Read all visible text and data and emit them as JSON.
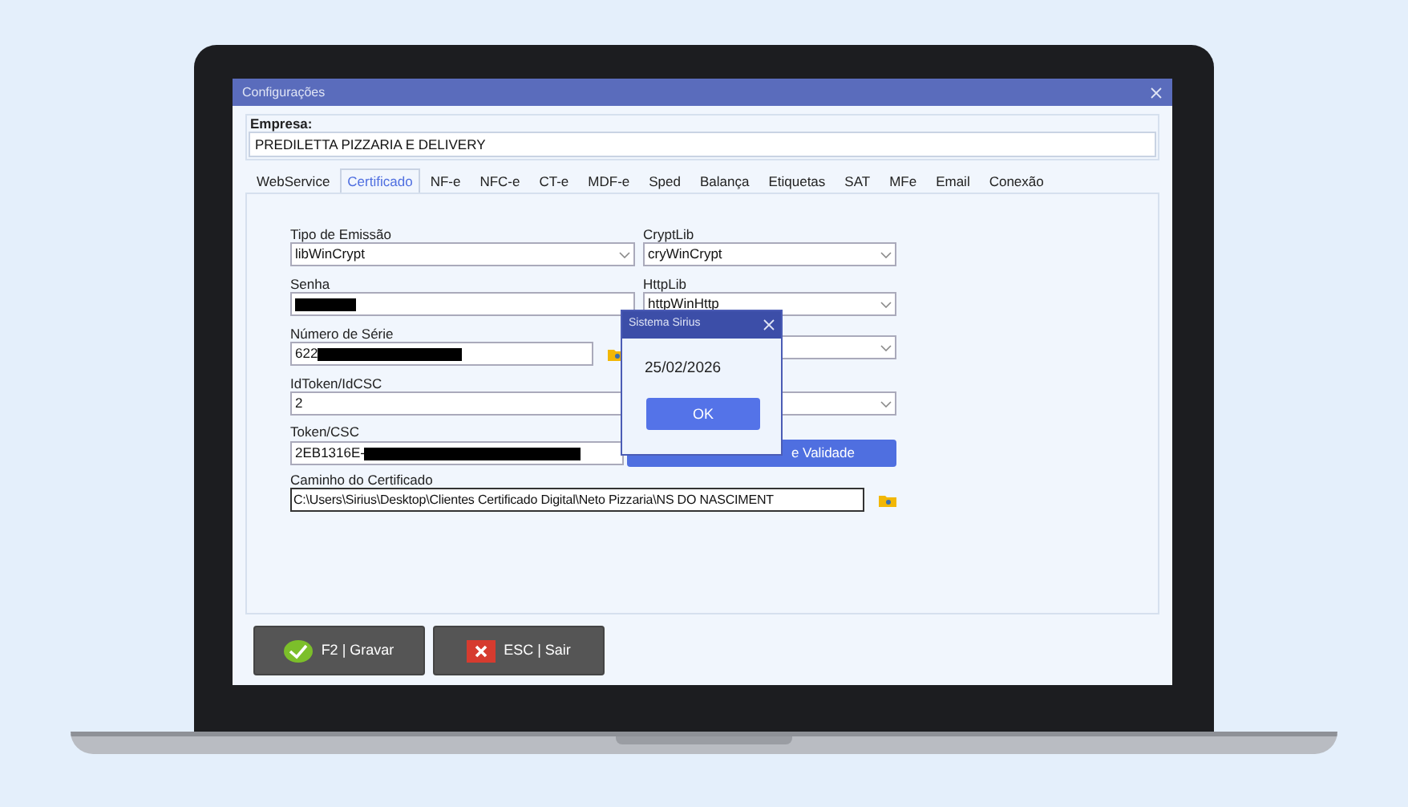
{
  "window": {
    "title": "Configurações"
  },
  "empresa": {
    "label": "Empresa:",
    "value": "PREDILETTA PIZZARIA E DELIVERY"
  },
  "tabs": [
    {
      "label": "WebService",
      "selected": false
    },
    {
      "label": "Certificado",
      "selected": true
    },
    {
      "label": "NF-e",
      "selected": false
    },
    {
      "label": "NFC-e",
      "selected": false
    },
    {
      "label": "CT-e",
      "selected": false
    },
    {
      "label": "MDF-e",
      "selected": false
    },
    {
      "label": "Sped",
      "selected": false
    },
    {
      "label": "Balança",
      "selected": false
    },
    {
      "label": "Etiquetas",
      "selected": false
    },
    {
      "label": "SAT",
      "selected": false
    },
    {
      "label": "MFe",
      "selected": false
    },
    {
      "label": "Email",
      "selected": false
    },
    {
      "label": "Conexão",
      "selected": false
    }
  ],
  "certificado": {
    "tipo_emissao": {
      "label": "Tipo de Emissão",
      "value": "libWinCrypt"
    },
    "cryptlib": {
      "label": "CryptLib",
      "value": "cryWinCrypt"
    },
    "senha": {
      "label": "Senha",
      "redacted": true
    },
    "httplib": {
      "label": "HttpLib",
      "value": "httpWinHttp"
    },
    "numero_serie": {
      "label": "Número de Série",
      "value": "622",
      "redacted": true
    },
    "id_token": {
      "label": "IdToken/IdCSC",
      "value": "2"
    },
    "token_csc": {
      "label": "Token/CSC",
      "value": "2EB1316E-",
      "redacted": true
    },
    "validade_button": {
      "label": "e Validade"
    },
    "caminho": {
      "label": "Caminho do Certificado",
      "value": "C:\\Users\\Sirius\\Desktop\\Clientes Certificado Digital\\Neto Pizzaria\\NS DO NASCIMENT"
    }
  },
  "dialog": {
    "title": "Sistema Sirius",
    "message": "25/02/2026",
    "button": "OK"
  },
  "buttons": [
    {
      "label": "F2 | Gravar",
      "kind": "save"
    },
    {
      "label": "ESC | Sair",
      "kind": "exit"
    }
  ]
}
